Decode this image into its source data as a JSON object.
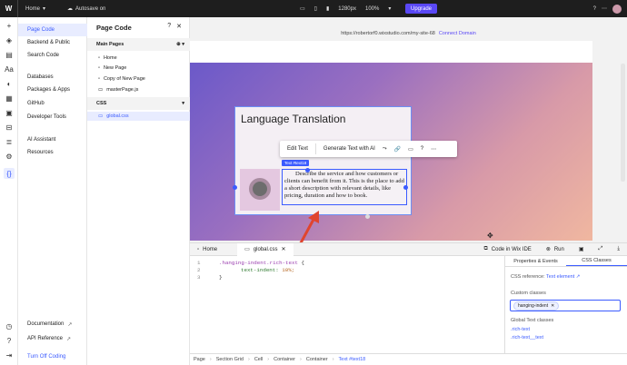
{
  "topbar": {
    "logo": "W",
    "home": "Home",
    "autosave": "Autosave on",
    "breakpoint": "1280px",
    "zoom": "100%",
    "upgrade": "Upgrade"
  },
  "rail_icons": [
    "add-icon",
    "layers-icon",
    "pages-icon",
    "text-icon",
    "design-icon",
    "apps-icon",
    "media-icon",
    "cms-icon",
    "code-icon"
  ],
  "sidemenu": {
    "items": [
      {
        "label": "Page Code",
        "active": true
      },
      {
        "label": "Backend & Public"
      },
      {
        "label": "Search Code"
      },
      {
        "label": "Databases"
      },
      {
        "label": "Packages & Apps"
      },
      {
        "label": "GitHub"
      },
      {
        "label": "Developer Tools"
      },
      {
        "label": "AI Assistant"
      },
      {
        "label": "Resources"
      }
    ],
    "bottom": [
      "Documentation",
      "API Reference",
      "Turn Off Coding"
    ]
  },
  "codepanel": {
    "title": "Page Code",
    "section_pages": "Main Pages",
    "pages": [
      "Home",
      "New Page",
      "Copy of New Page",
      "masterPage.js"
    ],
    "section_css": "CSS",
    "css_file": "global.css"
  },
  "canvas": {
    "url": "https://robertorf0.wixstudio.com/my-site-68",
    "connect": "Connect Domain",
    "card_title": "Language Translation",
    "body_text": "Describe the service and how customers or clients can benefit from it. This is the place to add a short description with relevant details, like pricing, duration and how to book.",
    "text_tag": "Text #text18",
    "floatbar": {
      "edit": "Edit Text",
      "ai": "Generate Text with AI"
    }
  },
  "bottom": {
    "tabs": [
      "Home",
      "global.css"
    ],
    "code_ide": "Code in Wix IDE",
    "run": "Run",
    "lines": [
      "1",
      "2",
      "3"
    ],
    "code_selector": ".hanging-indent.rich-text",
    "code_prop": "text-indent:",
    "code_val": "10%;",
    "props_tab1": "Properties & Events",
    "props_tab2": "CSS Classes",
    "css_ref_label": "CSS reference:",
    "css_ref_link": "Text element",
    "custom_classes": "Custom classes",
    "chip": "hanging-indent",
    "global_classes": "Global Text classes",
    "gc1": ".rich-text",
    "gc2": ".rich-text__text"
  },
  "breadcrumbs": [
    "Page",
    "Section Grid",
    "Cell",
    "Container",
    "Container",
    "Text #text18"
  ]
}
